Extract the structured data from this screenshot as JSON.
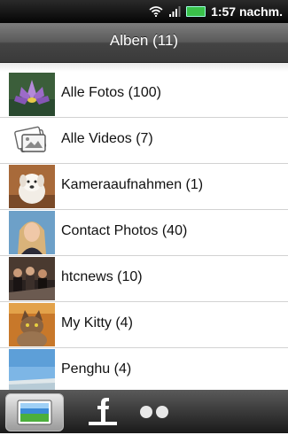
{
  "status": {
    "time": "1:57 nachm."
  },
  "header": {
    "title": "Alben (11)"
  },
  "albums": [
    {
      "label": "Alle Fotos (100)",
      "thumb": "lotus-flower-photo"
    },
    {
      "label": "Alle Videos (7)",
      "thumb": "video-icon"
    },
    {
      "label": "Kameraaufnahmen (1)",
      "thumb": "dog-photo"
    },
    {
      "label": "Contact Photos (40)",
      "thumb": "woman-portrait-photo"
    },
    {
      "label": "htcnews (10)",
      "thumb": "people-photo"
    },
    {
      "label": "My Kitty (4)",
      "thumb": "cat-photo"
    },
    {
      "label": "Penghu (4)",
      "thumb": "landscape-photo"
    }
  ],
  "tabs": [
    {
      "name": "gallery",
      "icon": "gallery-icon",
      "selected": true
    },
    {
      "name": "facebook",
      "icon": "facebook-icon",
      "selected": false
    },
    {
      "name": "flickr",
      "icon": "flickr-icon",
      "selected": false
    }
  ],
  "colors": {
    "battery": "#3ac14a",
    "header": "#5a5a5a",
    "divider": "#d2d2d2"
  }
}
